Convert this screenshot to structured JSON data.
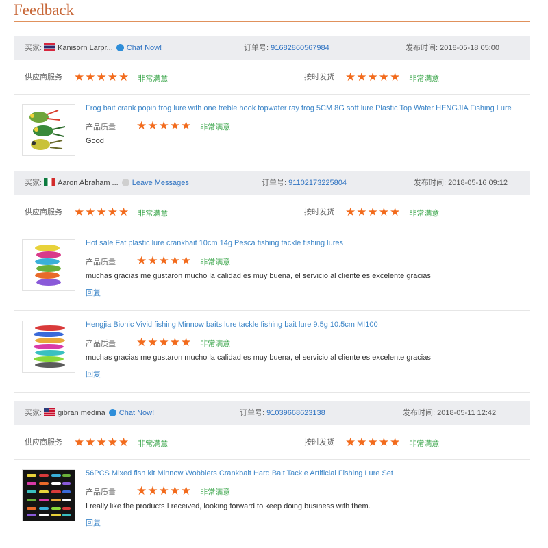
{
  "header": {
    "title": "Feedback"
  },
  "labels": {
    "buyer": "买家:",
    "order_no": "订单号:",
    "posted": "发布时间:",
    "supplier_service": "供应商服务",
    "ship_on_time": "按时发货",
    "product_quality": "产品质量",
    "very_satisfied": "非常满意",
    "reply": "回复",
    "stars": "★★★★★"
  },
  "orders": [
    {
      "buyer": "Kanisorn Larpr...",
      "flag": "thailand-flag",
      "action": "Chat Now!",
      "order_no": "91682860567984",
      "date": "2018-05-18 05:00",
      "products": [
        {
          "title": "Frog bait crank popin frog lure with one treble hook topwater ray frog 5CM 8G soft lure Plastic Top Water HENGJIA Fishing Lure",
          "comment": "Good",
          "has_reply": false
        }
      ]
    },
    {
      "buyer": "Aaron Abraham ...",
      "flag": "mexico-flag",
      "action": "Leave Messages",
      "order_no": "91102173225804",
      "date": "2018-05-16 09:12",
      "products": [
        {
          "title": "Hot sale Fat plastic lure crankbait 10cm 14g Pesca fishing tackle fishing lures",
          "comment": "muchas gracias me gustaron mucho la calidad es muy buena, el servicio al cliente es excelente gracias",
          "has_reply": true
        },
        {
          "title": "Hengjia Bionic Vivid fishing Minnow baits lure tackle fishing bait lure 9.5g 10.5cm MI100",
          "comment": "muchas gracias me gustaron mucho la calidad es muy buena, el servicio al cliente es excelente gracias",
          "has_reply": true
        }
      ]
    },
    {
      "buyer": "gibran medina",
      "flag": "usa-flag",
      "action": "Chat Now!",
      "order_no": "91039668623138",
      "date": "2018-05-11 12:42",
      "products": [
        {
          "title": "56PCS Mixed fish kit Minnow Wobblers Crankbait Hard Bait Tackle Artificial Fishing Lure Set",
          "comment": "I really like the products I received, looking forward to keep doing business with them.",
          "has_reply": true
        }
      ]
    }
  ],
  "colors": {
    "title": "#c8693a",
    "star": "#f26b1d",
    "satisfied": "#3aa54a",
    "link": "#3d86c8",
    "bar": "#ecedf0"
  }
}
